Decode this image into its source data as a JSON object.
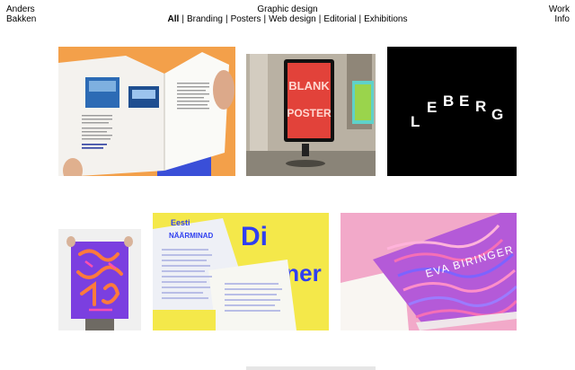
{
  "header": {
    "name_line1": "Anders",
    "name_line2": "Bakken",
    "section_title": "Graphic design",
    "filters": [
      {
        "label": "All",
        "active": true
      },
      {
        "label": "Branding"
      },
      {
        "label": "Posters"
      },
      {
        "label": "Web design"
      },
      {
        "label": "Editorial"
      },
      {
        "label": "Exhibitions"
      }
    ],
    "separator": "|",
    "nav_work": "Work",
    "nav_info": "Info"
  },
  "projects": [
    {
      "id": "book-spread"
    },
    {
      "id": "blank-poster",
      "text_line1": "BLANK",
      "text_line2": "POSTER"
    },
    {
      "id": "leberg-logo",
      "letters": [
        "L",
        "E",
        "B",
        "E",
        "R",
        "G"
      ]
    },
    {
      "id": "neon-poster"
    },
    {
      "id": "diner-print",
      "fragments": [
        "Di",
        "iner",
        "Eesti",
        "NÄÄRMINAD"
      ]
    },
    {
      "id": "eva-book",
      "text": "EVA BIRINGER"
    }
  ],
  "colors": {
    "text": "#000000",
    "background": "#ffffff",
    "leberg_bg": "#000000",
    "diner_yellow": "#f4e84a",
    "diner_blue": "#2f3ff0",
    "eva_pink": "#f2a9c9",
    "neon_purple": "#7b3fe0",
    "book_orange": "#f3a04a"
  }
}
